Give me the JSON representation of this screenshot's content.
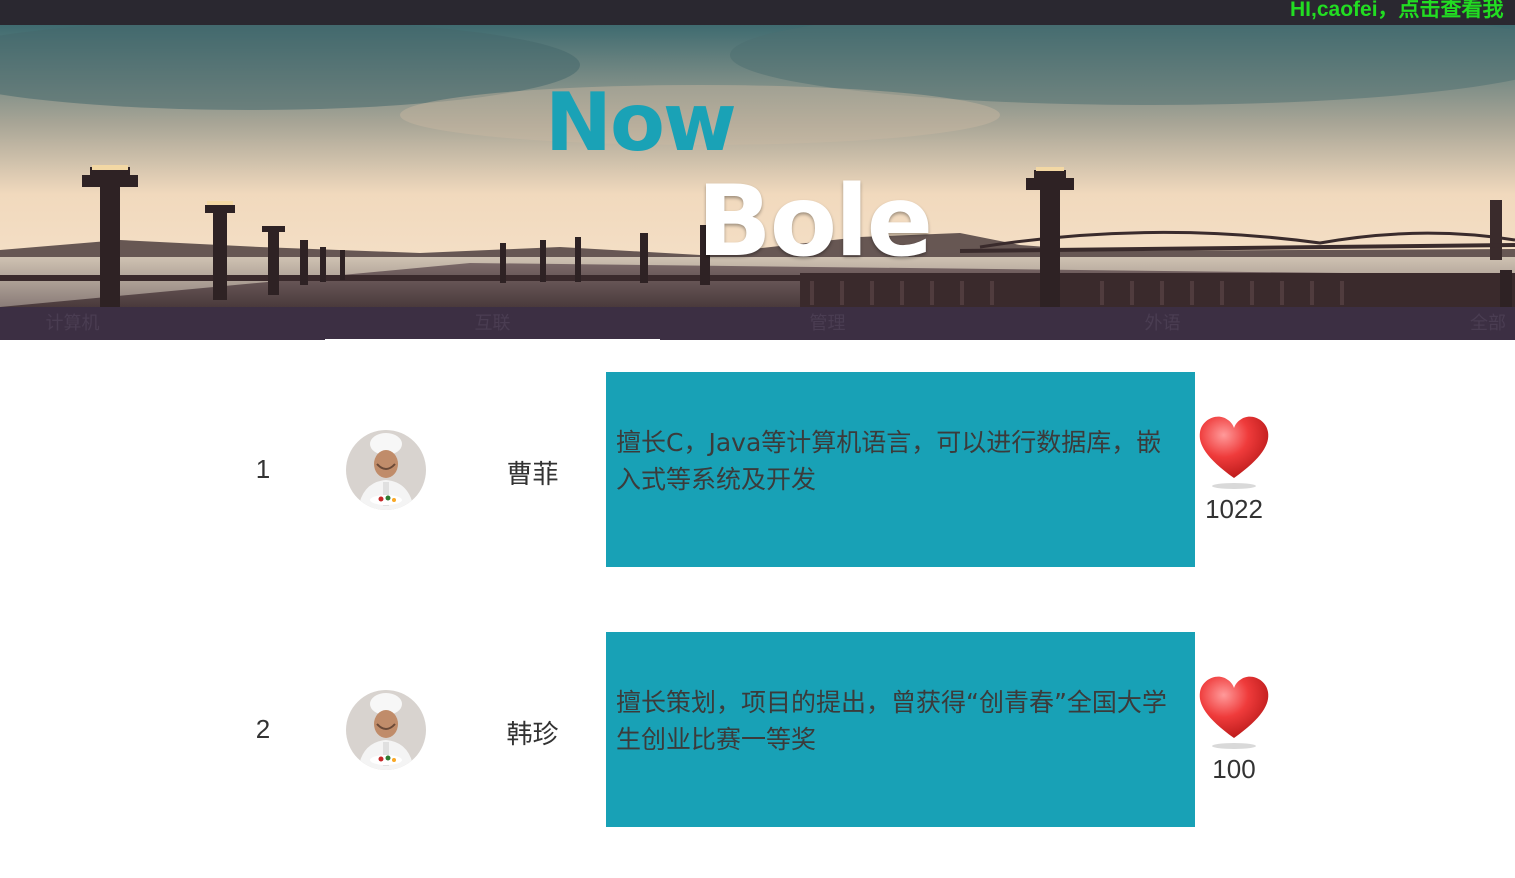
{
  "header": {
    "greeting": "HI,caofei，点击查看我"
  },
  "logo": {
    "word1": "Now",
    "word2": "Bole"
  },
  "nav": {
    "items": [
      {
        "label": "计算机"
      },
      {
        "label": "互联"
      },
      {
        "label": "管理"
      },
      {
        "label": "外语"
      },
      {
        "label": "全部"
      }
    ]
  },
  "rows": [
    {
      "rank": "1",
      "name": "曹菲",
      "description": "擅长C，Java等计算机语言，可以进行数据库，嵌入式等系统及开发",
      "likes": "1022"
    },
    {
      "rank": "2",
      "name": "韩珍",
      "description": "擅长策划，项目的提出，曾获得“创青春”全国大学生创业比赛一等奖",
      "likes": "100"
    }
  ],
  "colors": {
    "topbar": "#2a2830",
    "greeting": "#22dd22",
    "nav": "#3c2f43",
    "card": "#18a1b6",
    "logo_now": "#1aa2b6"
  },
  "icons": {
    "like": "heart-icon",
    "avatar": "chef-avatar"
  }
}
